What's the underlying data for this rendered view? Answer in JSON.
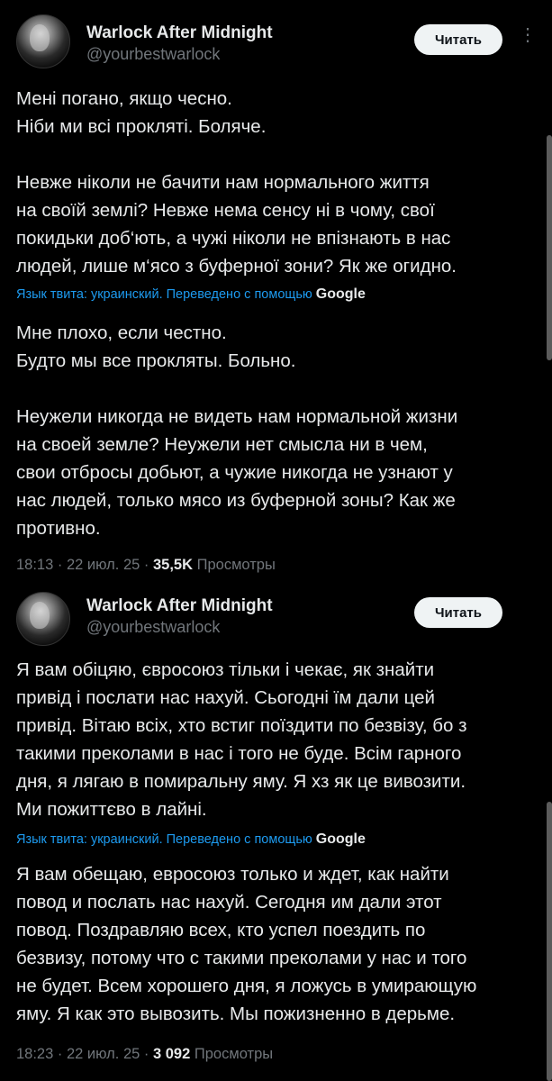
{
  "posts": [
    {
      "author_name": "Warlock After Midnight",
      "author_handle": "@yourbestwarlock",
      "read_button": "Читать",
      "original_text": "Мені погано, якщо чесно.\nНіби ми всі прокляті. Боляче.\n\nНевже ніколи не бачити нам нормального життя\nна своїй землі? Невже нема сенсу ні в чому, свої\nпокидьки доб‘ють, а чужі ніколи не впізнають в нас\nлюдей, лише м‘ясо з буферної зони? Як же огидно.",
      "translation_notice": "Язык твита: украинский. Переведено с помощью",
      "translation_provider": "Google",
      "translated_text": "Мне плохо, если честно.\nБудто мы все прокляты. Больно.\n\nНеужели никогда не видеть нам нормальной жизни\nна своей земле? Неужели нет смысла ни в чем,\nсвои отбросы добьют, а чужие никогда не узнают у\nнас людей, только мясо из буферной зоны? Как же\nпротивно.",
      "time": "18:13",
      "date": "22 июл. 25",
      "views_count": "35,5K",
      "views_label": "Просмотры"
    },
    {
      "author_name": "Warlock After Midnight",
      "author_handle": "@yourbestwarlock",
      "read_button": "Читать",
      "original_text": "Я вам обіцяю, євросоюз тільки і чекає, як знайти\nпривід і послати нас нахуй. Сьогодні їм дали цей\nпривід. Вітаю всіх, хто встиг поїздити по безвізу, бо з\nтакими преколами в нас і того не буде. Всім гарного\nдня, я лягаю в помиральну яму. Я хз як це вивозити.\nМи пожиттєво в лайні.",
      "translation_notice": "Язык твита: украинский. Переведено с помощью",
      "translation_provider": "Google",
      "translated_text": "Я вам обещаю, евросоюз только и ждет, как найти\nповод и послать нас нахуй. Сегодня им дали этот\nповод. Поздравляю всех, кто успел поездить по\nбезвизу, потому что с такими преколами у нас и того\nне будет. Всем хорошего дня, я ложусь в умирающую\nяму. Я как это вывозить. Мы пожизненно в дерьме.",
      "time": "18:23",
      "date": "22 июл. 25",
      "views_count": "3 092",
      "views_label": "Просмотры"
    }
  ],
  "meta_separator": "·"
}
